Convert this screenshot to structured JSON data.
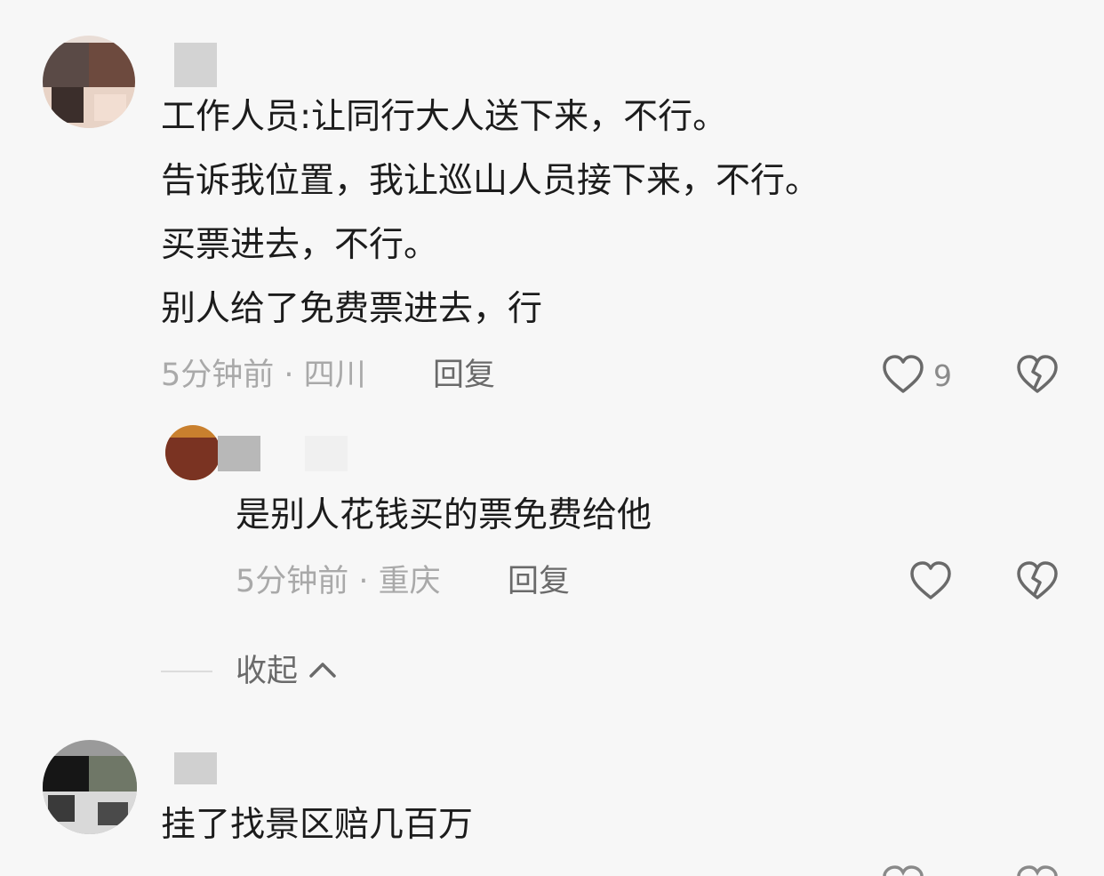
{
  "comments": [
    {
      "lines": [
        "工作人员:让同行大人送下来，不行。",
        "告诉我位置，我让巡山人员接下来，不行。",
        "买票进去，不行。",
        "别人给了免费票进去，行"
      ],
      "meta": "5分钟前 · 四川",
      "reply_label": "回复",
      "like_count": "9",
      "like_icon": "heart-outline-icon",
      "dislike_icon": "broken-heart-icon",
      "replies": [
        {
          "text": "是别人花钱买的票免费给他",
          "meta": "5分钟前 · 重庆",
          "reply_label": "回复"
        }
      ],
      "collapse_label": "收起"
    },
    {
      "lines": [
        "挂了找景区赔几百万"
      ]
    }
  ],
  "colors": {
    "text": "#1c1c1c",
    "meta": "#a9a9a9",
    "action": "#6a6a6a"
  }
}
